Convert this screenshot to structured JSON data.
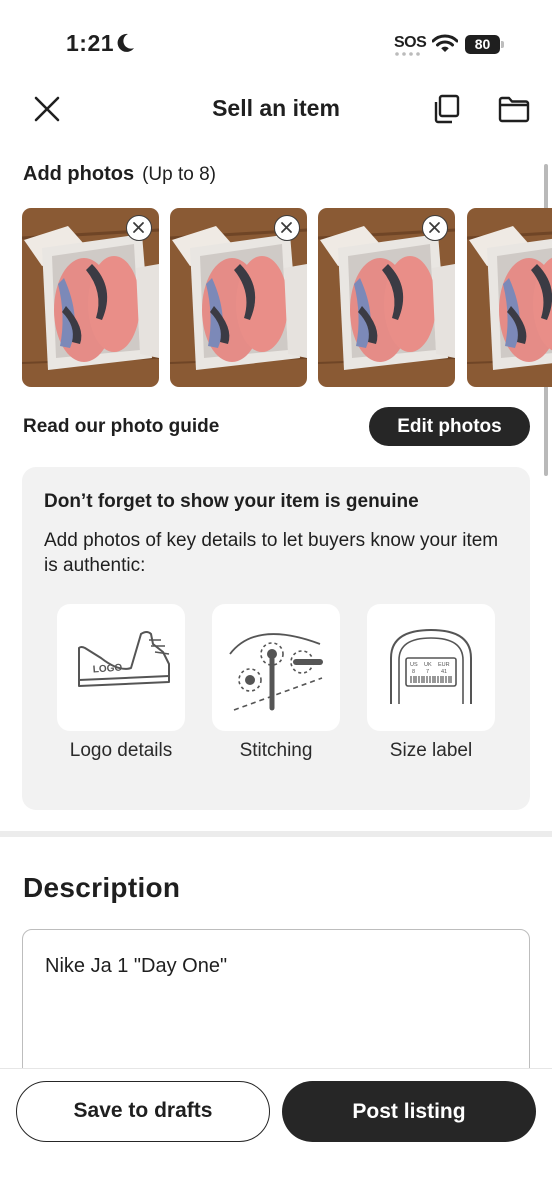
{
  "status_bar": {
    "time": "1:21",
    "sos": "SOS",
    "battery": "80"
  },
  "header": {
    "title": "Sell an item"
  },
  "photos": {
    "heading": "Add photos",
    "limit": "(Up to 8)",
    "guide_link": "Read our photo guide",
    "edit_button": "Edit photos"
  },
  "genuine": {
    "title": "Don’t forget to show your item is genuine",
    "body": "Add photos of key details to let buyers know your item is authentic:",
    "tiles": [
      {
        "label": "Logo details",
        "art_text": "LOGO"
      },
      {
        "label": "Stitching"
      },
      {
        "label": "Size label",
        "art_text": [
          "US",
          "UK",
          "EUR",
          "8",
          "7",
          "41"
        ]
      }
    ]
  },
  "description": {
    "heading": "Description",
    "value": "Nike Ja 1 \"Day One\""
  },
  "footer": {
    "save_label": "Save to drafts",
    "post_label": "Post listing"
  }
}
